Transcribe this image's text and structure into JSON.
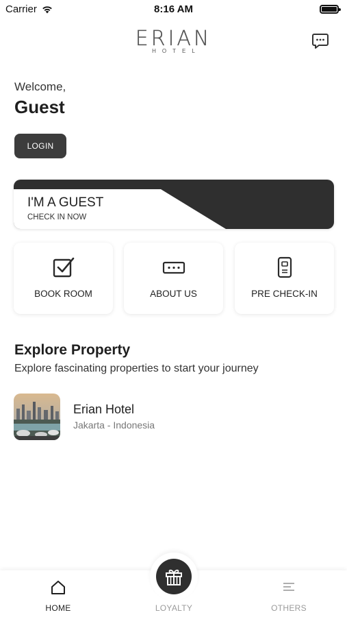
{
  "status_bar": {
    "carrier": "Carrier",
    "time": "8:16 AM"
  },
  "header": {
    "logo_text": "ERIAN",
    "logo_subtext": "HOTEL"
  },
  "welcome": {
    "greeting": "Welcome,",
    "name": "Guest",
    "login_label": "LOGIN"
  },
  "guest_banner": {
    "title": "I'M A GUEST",
    "subtitle": "CHECK IN NOW"
  },
  "quick_actions": [
    {
      "label": "BOOK ROOM",
      "icon": "checkbox-icon"
    },
    {
      "label": "ABOUT US",
      "icon": "ticket-icon"
    },
    {
      "label": "PRE CHECK-IN",
      "icon": "key-card-icon"
    }
  ],
  "explore": {
    "title": "Explore Property",
    "subtitle": "Explore fascinating properties to start your journey",
    "properties": [
      {
        "name": "Erian Hotel",
        "location": "Jakarta - Indonesia"
      }
    ]
  },
  "bottom_nav": {
    "items": [
      {
        "label": "HOME",
        "icon": "home-icon",
        "active": true
      },
      {
        "label": "LOYALTY",
        "icon": "gift-icon",
        "active": false
      },
      {
        "label": "OTHERS",
        "icon": "menu-lines-icon",
        "active": false
      }
    ]
  },
  "colors": {
    "dark": "#2f2f2f",
    "button": "#3c3c3c",
    "muted": "#9a9a9a",
    "background": "#ffffff"
  }
}
